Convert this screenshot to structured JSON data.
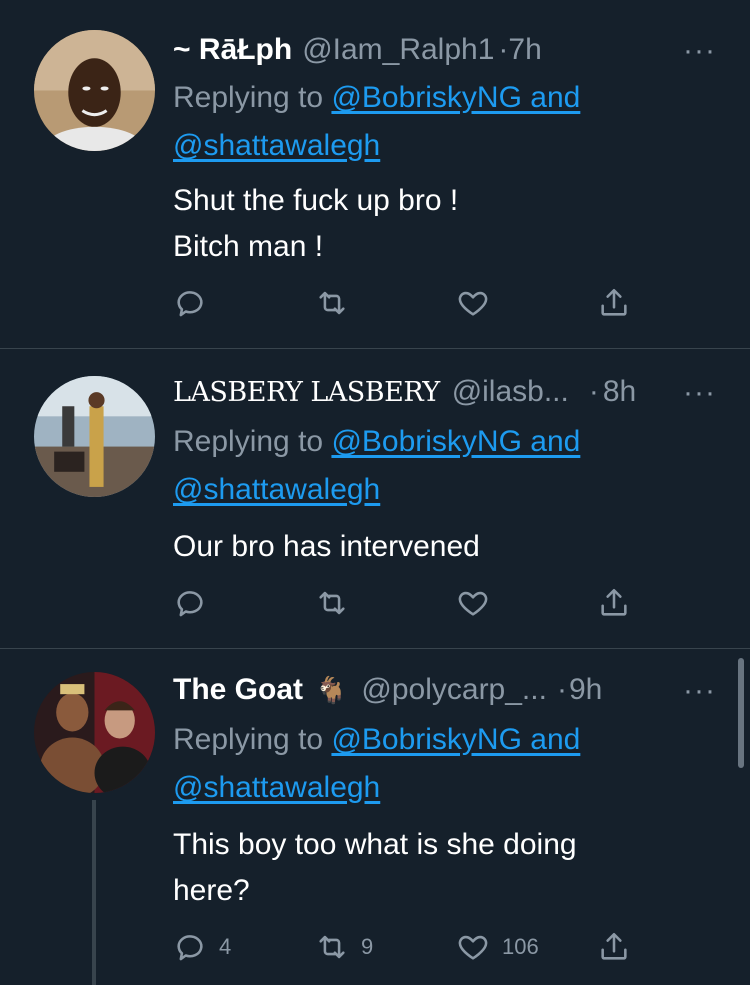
{
  "tweets": [
    {
      "display_name": "~ RāŁph",
      "handle": "@Iam_Ralph1",
      "separator": "·",
      "time": "7h",
      "more": "···",
      "replying_prefix": "Replying to ",
      "replying_user1": "@BobriskyNG and",
      "replying_user2": "@shattawalegh",
      "text": "Shut the fuck up bro !\nBitch man !",
      "reply_count": "",
      "retweet_count": "",
      "like_count": ""
    },
    {
      "display_name": "LASBERY LASBERY",
      "handle": "@ilasb...",
      "separator": "·",
      "time": "8h",
      "more": "···",
      "replying_prefix": "Replying to ",
      "replying_user1": "@BobriskyNG and",
      "replying_user2": "@shattawalegh",
      "text": "Our bro has intervened",
      "reply_count": "",
      "retweet_count": "",
      "like_count": ""
    },
    {
      "display_name": "The Goat",
      "emoji": "🐐",
      "handle": "@polycarp_...",
      "separator": "·",
      "time": "9h",
      "more": "···",
      "replying_prefix": "Replying to ",
      "replying_user1": "@BobriskyNG and",
      "replying_user2": "@shattawalegh",
      "text": "This boy too what is she doing\nhere?",
      "reply_count": "4",
      "retweet_count": "9",
      "like_count": "106"
    }
  ],
  "icons": [
    "reply-icon",
    "retweet-icon",
    "like-icon",
    "share-icon",
    "more-icon"
  ],
  "colors": {
    "background": "#15202b",
    "link": "#1d9bf0",
    "muted": "#8b98a5",
    "divider": "#38444d"
  }
}
